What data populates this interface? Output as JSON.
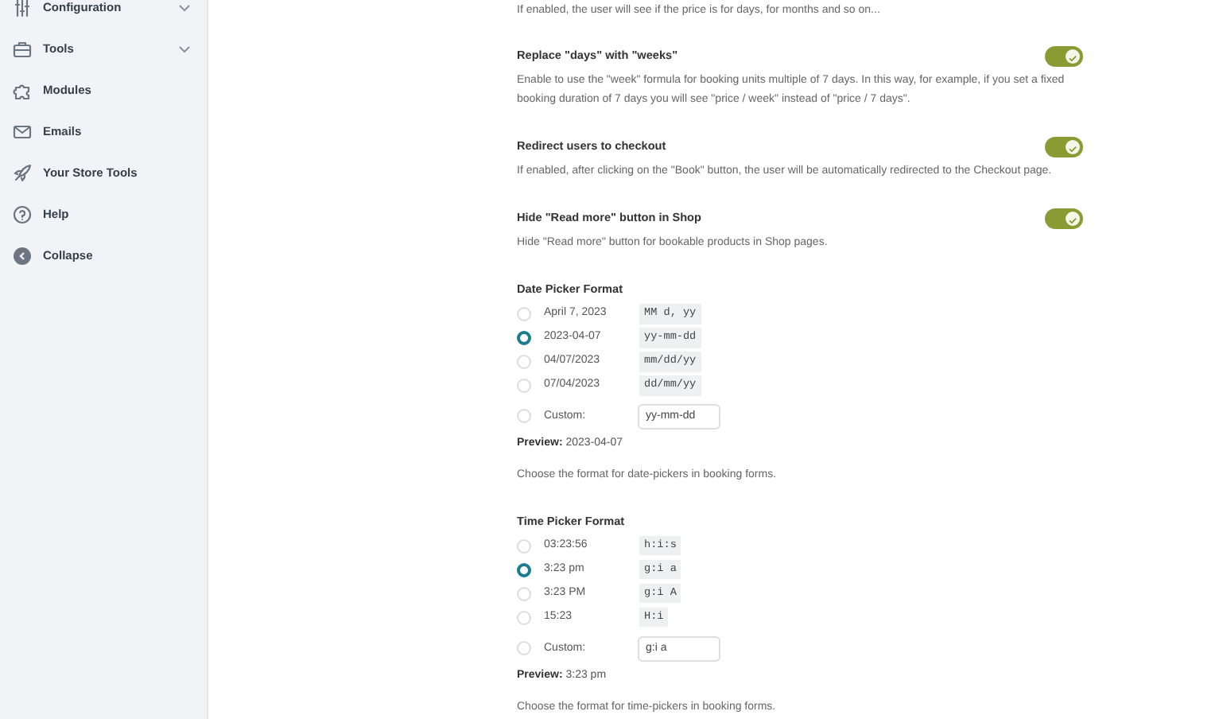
{
  "sidebar": {
    "items": [
      {
        "label": "Configuration",
        "has_submenu": true
      },
      {
        "label": "Tools",
        "has_submenu": true
      },
      {
        "label": "Modules",
        "has_submenu": false
      },
      {
        "label": "Emails",
        "has_submenu": false
      },
      {
        "label": "Your Store Tools",
        "has_submenu": false
      },
      {
        "label": "Help",
        "has_submenu": false
      },
      {
        "label": "Collapse",
        "has_submenu": false
      }
    ]
  },
  "top_description": "If enabled, the user will see if the price is for days, for months and so on...",
  "settings": [
    {
      "title": "Replace \"days\" with \"weeks\"",
      "description": "Enable to use the \"week\" formula for booking units multiple of 7 days. In this way, for example, if you set a fixed booking duration of 7 days you will see \"price / week\" instead of \"price / 7 days\".",
      "on": true
    },
    {
      "title": "Redirect users to checkout",
      "description": "If enabled, after clicking on the \"Book\" button, the user will be automatically redirected to the Checkout page.",
      "on": true
    },
    {
      "title": "Hide \"Read more\" button in Shop",
      "description": "Hide \"Read more\" button for bookable products in Shop pages.",
      "on": true
    }
  ],
  "pickers": [
    {
      "title": "Date Picker Format",
      "options": [
        {
          "kind": "preset",
          "label": "April 7, 2023",
          "format": "MM d, yy",
          "selected": false
        },
        {
          "kind": "preset",
          "label": "2023-04-07",
          "format": "yy-mm-dd",
          "selected": true
        },
        {
          "kind": "preset",
          "label": "04/07/2023",
          "format": "mm/dd/yy",
          "selected": false
        },
        {
          "kind": "preset",
          "label": "07/04/2023",
          "format": "dd/mm/yy",
          "selected": false
        },
        {
          "kind": "custom",
          "label": "Custom:",
          "value": "yy-mm-dd",
          "selected": false
        }
      ],
      "preview_label": "Preview:",
      "preview_value": "2023-04-07",
      "help": "Choose the format for date-pickers in booking forms."
    },
    {
      "title": "Time Picker Format",
      "options": [
        {
          "kind": "preset",
          "label": "03:23:56",
          "format": "h:i:s",
          "selected": false
        },
        {
          "kind": "preset",
          "label": "3:23 pm",
          "format": "g:i a",
          "selected": true
        },
        {
          "kind": "preset",
          "label": "3:23 PM",
          "format": "g:i A",
          "selected": false
        },
        {
          "kind": "preset",
          "label": "15:23",
          "format": "H:i",
          "selected": false
        },
        {
          "kind": "custom",
          "label": "Custom:",
          "value": "g:i a",
          "selected": false
        }
      ],
      "preview_label": "Preview:",
      "preview_value": "3:23 pm",
      "help": "Choose the format for time-pickers in booking forms."
    }
  ]
}
